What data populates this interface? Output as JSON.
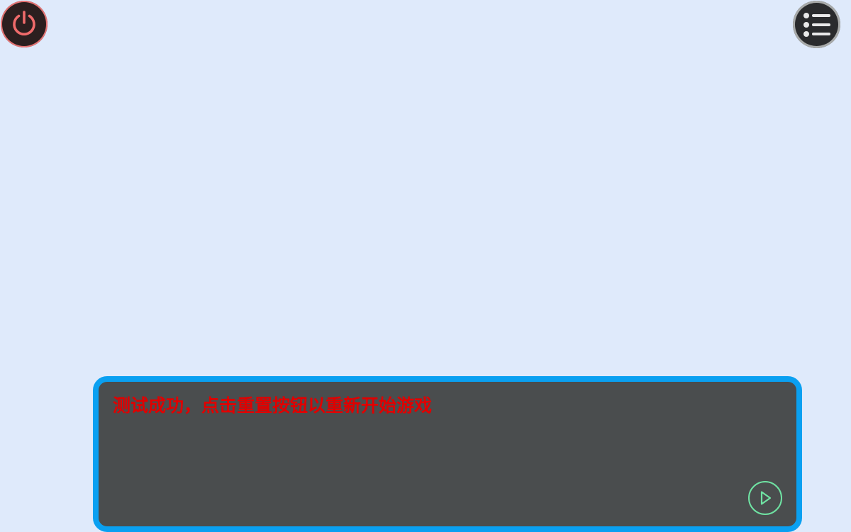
{
  "controls": {
    "power_icon": "power-icon",
    "menu_icon": "list-menu-icon",
    "next_icon": "play-next-icon"
  },
  "dialog": {
    "message": "测试成功，点击重置按钮以重新开始游戏"
  },
  "colors": {
    "background": "#dfeafb",
    "dialog_border": "#0aa0f1",
    "dialog_fill": "#4a4d4e",
    "message_text": "#e00000",
    "power_ring": "#e57373",
    "next_ring": "#6fe3a3"
  }
}
